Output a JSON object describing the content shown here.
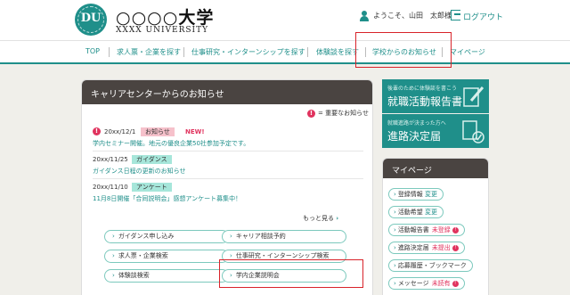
{
  "header": {
    "logo_mark": "DU",
    "university_name": "○○○○大学",
    "university_sub": "XXXX UNIVERSITY",
    "greeting": "ようこそ、山田　太郎様",
    "logout": "ログアウト"
  },
  "nav": {
    "items": [
      "TOP",
      "求人票・企業を探す",
      "仕事研究・インターンシップを探す",
      "体験談を探す",
      "学校からのお知らせ",
      "マイページ"
    ],
    "highlighted": "学校からのお知らせ"
  },
  "notices": {
    "title": "キャリアセンターからのお知らせ",
    "legend_icon": "!",
    "legend_text": "= 重要なお知らせ",
    "items": [
      {
        "date": "20xx/12/1",
        "tag": "お知らせ",
        "new": "NEW!",
        "text": "学内セミナー開催。地元の優良企業50社参加予定です。"
      },
      {
        "date": "20xx/11/25",
        "tag": "ガイダンス",
        "text": "ガイダンス日程の更新のお知らせ"
      },
      {
        "date": "20xx/11/10",
        "tag": "アンケート",
        "text": "11月8日開催「合同説明会」感想アンケート募集中！"
      }
    ],
    "more": "もっと見る",
    "buttons": [
      "ガイダンス申し込み",
      "キャリア相談予約",
      "求人票・企業検索",
      "仕事研究・インターンシップ検索",
      "体験談検索",
      "学内企業説明会"
    ]
  },
  "banners": [
    {
      "small": "後輩のために体験談を書こう",
      "big": "就職活動報告書"
    },
    {
      "small": "就職進路が決まった方へ",
      "big": "進路決定届"
    }
  ],
  "mypage": {
    "title": "マイページ",
    "items": [
      {
        "label": "登録情報",
        "action": "変更"
      },
      {
        "label": "活動希望",
        "action": "変更"
      },
      {
        "label": "活動報告書",
        "status": "未登録",
        "badge": "!"
      },
      {
        "label": "進路決定届",
        "status": "未提出",
        "badge": "!"
      },
      {
        "label": "応募履歴・ブックマーク"
      },
      {
        "label": "メッセージ",
        "status": "未読有",
        "badge": "!"
      }
    ]
  },
  "colors": {
    "accent": "#1f8f8a",
    "header_dark": "#4a4441",
    "alert": "#e0335e",
    "highlight": "#d8232a"
  }
}
